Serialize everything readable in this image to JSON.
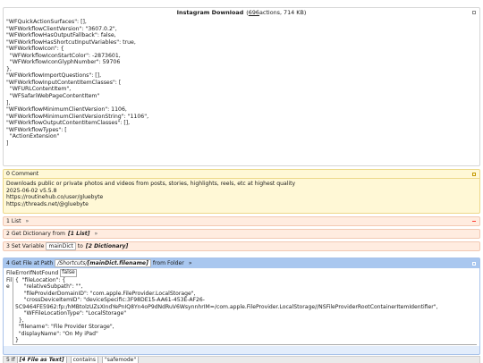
{
  "header": {
    "title": "Instagram Download",
    "paren_open": "(",
    "action_count": "696",
    "actions_suffix": " actions, 714 KB)"
  },
  "json_text": "\"WFQuickActionSurfaces\": [],\n\"WFWorkflowClientVersion\": \"3607.0.2\",\n\"WFWorkflowHasOutputFallback\": false,\n\"WFWorkflowHasShortcutInputVariables\": true,\n\"WFWorkflowIcon\": {\n  \"WFWorkflowIconStartColor\": -2873601,\n  \"WFWorkflowIconGlyphNumber\": 59706\n},\n\"WFWorkflowImportQuestions\": [],\n\"WFWorkflowInputContentItemClasses\": [\n  \"WFURLContentItem\",\n  \"WFSafariWebPageContentItem\"\n],\n\"WFWorkflowMinimumClientVersion\": 1106,\n\"WFWorkflowMinimumClientVersionString\": \"1106\",\n\"WFWorkflowOutputContentItemClasses\": [],\n\"WFWorkflowTypes\": [\n  \"ActionExtension\"\n]",
  "comment": {
    "header": "0 Comment",
    "lines": [
      "Downloads public or private photos and videos from posts, stories, highlights, reels, etc at highest quality",
      "2025-06-02   v5.5.8",
      "https://routinehub.co/user/gluebyte",
      "https://threads.net/@gluebyte"
    ]
  },
  "rows": {
    "list_label": "1 List",
    "arrow": "»",
    "getdict_label": "2 Get Dictionary from",
    "getdict_token": "[1 List]",
    "setvar_label": "3 Set Variable",
    "setvar_name": "mainDict",
    "setvar_to": "to",
    "setvar_token": "[2 Dictionary]"
  },
  "getfile": {
    "header_label": "4 Get File at Path",
    "path_prefix": "/Shortcuts/",
    "path_var": "[mainDict.filename]",
    "from_folder": "from Folder",
    "fnf_label": "FileErrorIfNotFound",
    "fnf_value": "false",
    "file_label": "File",
    "file_json": "{  \"fileLocation\": {\n     \"relativeSubpath\": \"\",\n     \"fileProviderDomainID\": \"com.apple.FileProvider.LocalStorage\",\n     \"crossDeviceItemID\": \"deviceSpecific:3F98DE15-AA61-453E-AF26-\n5C9464FE5962:fp:/hMBtolzUZsXIndYePnIQ8Yn4oP9dNdRuV6WsynnhrIM=/com.apple.FileProvider.LocalStorage//NSFileProviderRootContainerItemIdentifier\",\n     \"WFFileLocationType\": \"LocalStorage\"\n  },\n  \"filename\": \"File Provider Storage\",\n  \"displayName\": \"On My iPad\"\n}"
  },
  "if_row": {
    "label": "5 If",
    "token": "[4 File as Text]",
    "op": "contains",
    "value": "\"safemode\""
  },
  "colors": {
    "comment_bg": "#fff8d6",
    "row_bg": "#ffece0",
    "blue_header": "#a9c7ef",
    "minus": "#ff3b30"
  }
}
